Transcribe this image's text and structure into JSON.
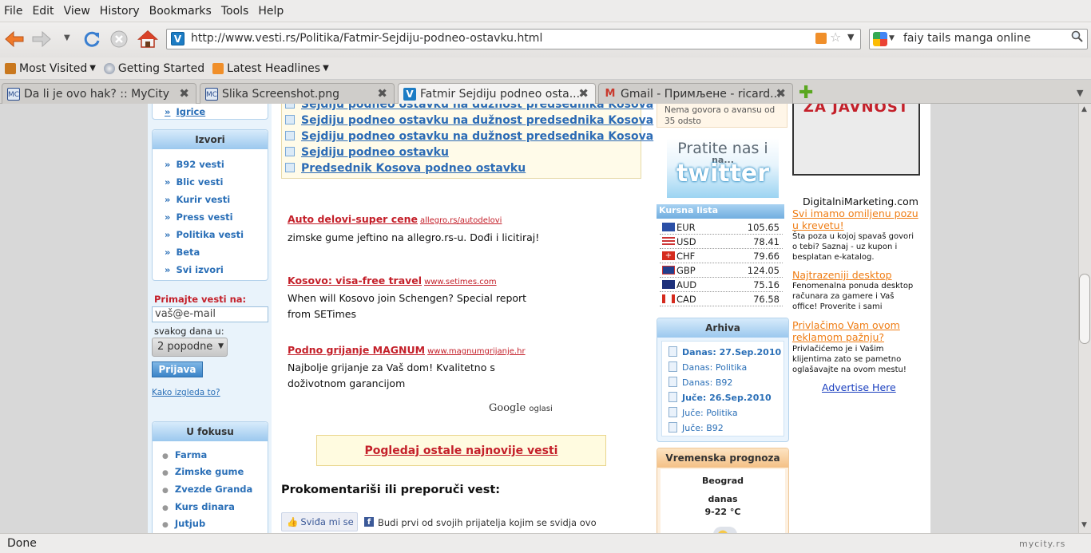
{
  "menu": [
    "File",
    "Edit",
    "View",
    "History",
    "Bookmarks",
    "Tools",
    "Help"
  ],
  "nav": {
    "url": "http://www.vesti.rs/Politika/Fatmir-Sejdiju-podneo-ostavku.html",
    "url_favicon_letter": "V",
    "search_value": "faiy tails manga online"
  },
  "bookmarks": [
    {
      "label": "Most Visited",
      "icon": "bookmark-star-icon",
      "has_menu": true
    },
    {
      "label": "Getting Started",
      "icon": "firefox-icon",
      "has_menu": false
    },
    {
      "label": "Latest Headlines",
      "icon": "rss-icon",
      "has_menu": true
    }
  ],
  "tabs": [
    {
      "label": "Da li je ovo hak? :: MyCity",
      "fav": "MC",
      "active": false
    },
    {
      "label": "Slika Screenshot.png",
      "fav": "MC",
      "active": false
    },
    {
      "label": "Fatmir Sejdiju podneo osta...",
      "fav": "V",
      "active": true
    },
    {
      "label": "Gmail - Примљене - ricard...",
      "fav": "M",
      "active": false
    }
  ],
  "left": {
    "top_link": "Igrice",
    "izvori_title": "Izvori",
    "izvori": [
      "B92 vesti",
      "Blic vesti",
      "Kurir vesti",
      "Press vesti",
      "Politika vesti",
      "Beta",
      "Svi izvori"
    ],
    "subscribe_label": "Primajte vesti na:",
    "email_value": "vaš@e-mail",
    "period_label": "svakog dana u:",
    "period_value": "2 popodne",
    "submit_label": "Prijava",
    "preview_link": "Kako izgleda to?",
    "fokus_title": "U fokusu",
    "fokus": [
      "Farma",
      "Zimske gume",
      "Zvezde Granda",
      "Kurs dinara",
      "Jutjub"
    ]
  },
  "main": {
    "related": [
      "Sejdiju podneo ostavku na dužnost predsednika Kosova",
      "Sejdiju podneo ostavku na dužnost predsednika Kosova",
      "Sejdiju podneo ostavku na dužnost predsednika Kosova",
      "Sejdiju podneo ostavku",
      "Predsednik Kosova podneo ostavku"
    ],
    "ads": [
      {
        "title": "Auto delovi-super cene",
        "url": "allegro.rs/autodelovi",
        "text": "zimske gume jeftino na allegro.rs-u. Dođi i licitiraj!"
      },
      {
        "title": "Kosovo: visa-free travel",
        "url": "www.setimes.com",
        "text": "When will Kosovo join Schengen? Special report from SETimes"
      },
      {
        "title": "Podno grijanje MAGNUM",
        "url": "www.magnumgrijanje.hr",
        "text": "Najbolje grijanje za Vaš dom! Kvalitetno s doživotnom garancijom"
      }
    ],
    "google_brand": "Google",
    "google_suffix": "oglasi",
    "more_news": "Pogledaj ostale najnovije vesti",
    "comment_heading": "Prokomentariši ili preporuči vest:",
    "like_label": "Sviđa mi se",
    "like_text": "Budi prvi od svojih prijatelja kojim se svidja ovo"
  },
  "right": {
    "top_snippet": "Nema govora o avansu od 35 odsto",
    "twitter_line1": "Pratite nas i",
    "twitter_line2": "na...",
    "twitter_logo": "twitter",
    "kursna_title": "Kursna lista",
    "rates": [
      {
        "code": "EUR",
        "value": "105.65"
      },
      {
        "code": "USD",
        "value": "78.41"
      },
      {
        "code": "CHF",
        "value": "79.66"
      },
      {
        "code": "GBP",
        "value": "124.05"
      },
      {
        "code": "AUD",
        "value": "75.16"
      },
      {
        "code": "CAD",
        "value": "76.58"
      }
    ],
    "arhiva_title": "Arhiva",
    "arhiva": [
      {
        "label": "Danas: 27.Sep.2010",
        "bold": true
      },
      {
        "label": "Danas: Politika",
        "bold": false
      },
      {
        "label": "Danas: B92",
        "bold": false
      },
      {
        "label": "Juče: 26.Sep.2010",
        "bold": true
      },
      {
        "label": "Juče: Politika",
        "bold": false
      },
      {
        "label": "Juče: B92",
        "bold": false
      }
    ],
    "weather_title": "Vremenska prognoza",
    "weather_city": "Beograd",
    "weather_day": "danas",
    "weather_temp": "9-22 °C"
  },
  "far_right": {
    "banner_text": "ZA JAVNOST",
    "dm_site": "DigitalniMarketing.com",
    "dm_items": [
      {
        "title": "Svi imamo omiljenu pozu u krevetu!",
        "text": "Šta poza u kojoj spavaš govori o tebi? Saznaj - uz kupon i besplatan e-katalog."
      },
      {
        "title": "Najtrazeniji desktop",
        "text": "Fenomenalna ponuda desktop računara za gamere i Vaš office! Proverite i sami"
      },
      {
        "title": "Privlačimo Vam ovom reklamom pažnju?",
        "text": "Privlačićemo je i Vašim klijentima zato se pametno oglašavajte na ovom mestu!"
      }
    ],
    "advertise": "Advertise Here"
  },
  "status": {
    "text": "Done",
    "watermark": "mycity.rs"
  }
}
